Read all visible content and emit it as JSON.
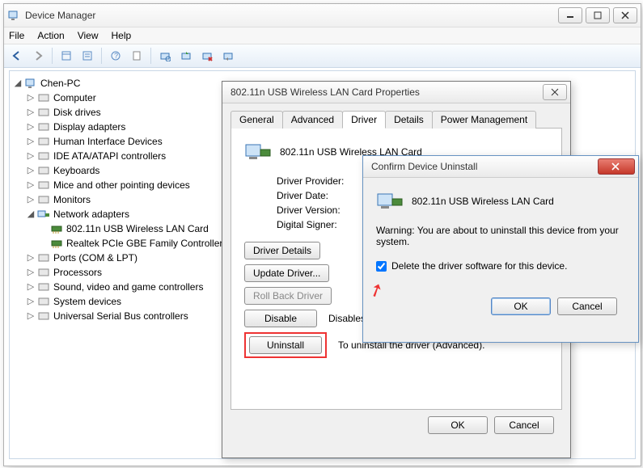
{
  "window": {
    "title": "Device Manager"
  },
  "menu": {
    "file": "File",
    "action": "Action",
    "view": "View",
    "help": "Help"
  },
  "tree": {
    "root": "Chen-PC",
    "items": [
      "Computer",
      "Disk drives",
      "Display adapters",
      "Human Interface Devices",
      "IDE ATA/ATAPI controllers",
      "Keyboards",
      "Mice and other pointing devices",
      "Monitors",
      "Network adapters",
      "Ports (COM & LPT)",
      "Processors",
      "Sound, video and game controllers",
      "System devices",
      "Universal Serial Bus controllers"
    ],
    "net_children": [
      "802.11n USB Wireless LAN Card",
      "Realtek PCIe GBE Family Controller"
    ]
  },
  "props": {
    "title": "802.11n USB Wireless LAN Card Properties",
    "tabs": {
      "general": "General",
      "advanced": "Advanced",
      "driver": "Driver",
      "details": "Details",
      "power": "Power Management"
    },
    "device_name": "802.11n USB Wireless LAN Card",
    "labels": {
      "provider": "Driver Provider:",
      "date": "Driver Date:",
      "version": "Driver Version:",
      "signer": "Digital Signer:"
    },
    "buttons": {
      "details": "Driver Details",
      "update": "Update Driver...",
      "rollback": "Roll Back Driver",
      "disable": "Disable",
      "uninstall": "Uninstall",
      "ok": "OK",
      "cancel": "Cancel"
    },
    "desc": {
      "disable": "Disables the selected device.",
      "uninstall": "To uninstall the driver (Advanced)."
    }
  },
  "confirm": {
    "title": "Confirm Device Uninstall",
    "device_name": "802.11n USB Wireless LAN Card",
    "warning": "Warning: You are about to uninstall this device from your system.",
    "checkbox": "Delete the driver software for this device.",
    "ok": "OK",
    "cancel": "Cancel"
  }
}
